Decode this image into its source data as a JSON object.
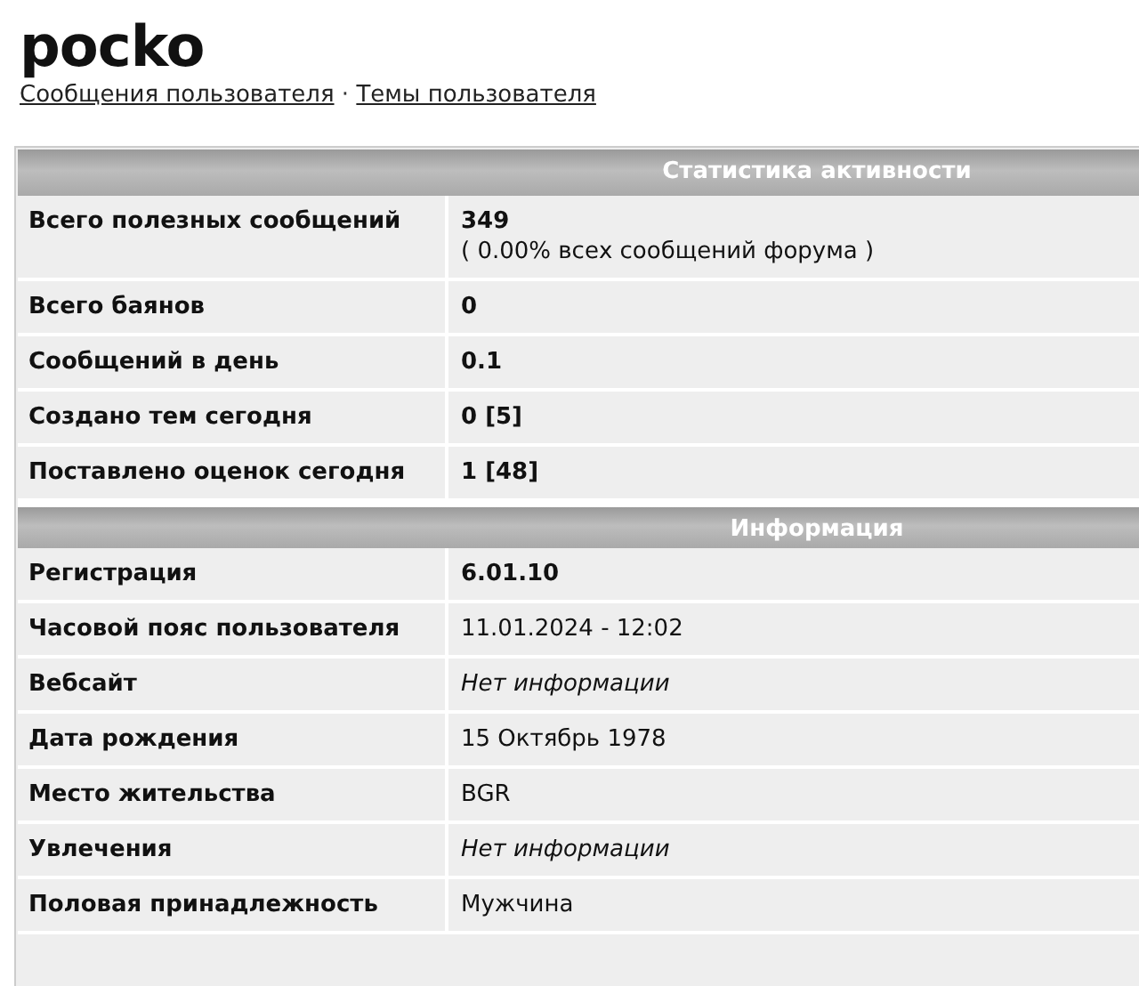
{
  "title": "pocko",
  "links": [
    "Сообщения пользователя",
    "Темы пользователя"
  ],
  "link_separator": "·",
  "sections": [
    {
      "heading": "Статистика активности",
      "rows": [
        {
          "label": "Всего полезных сообщений",
          "value": "349",
          "kind": "bold",
          "note": "( 0.00% всех сообщений форума )"
        },
        {
          "label": "Всего баянов",
          "value": "0",
          "kind": "bold"
        },
        {
          "label": "Сообщений в день",
          "value": "0.1",
          "kind": "bold"
        },
        {
          "label": "Создано тем сегодня",
          "value": "0 [5]",
          "kind": "bold"
        },
        {
          "label": "Поставлено оценок сегодня",
          "value": "1 [48]",
          "kind": "bold"
        }
      ]
    },
    {
      "heading": "Информация",
      "rows": [
        {
          "label": "Регистрация",
          "value": "6.01.10",
          "kind": "bold"
        },
        {
          "label": "Часовой пояс пользователя",
          "value": "11.01.2024 - 12:02",
          "kind": "plain"
        },
        {
          "label": "Вебсайт",
          "value": "Нет информации",
          "kind": "italic"
        },
        {
          "label": "Дата рождения",
          "value": "15 Октябрь 1978",
          "kind": "plain"
        },
        {
          "label": "Место жительства",
          "value": "BGR",
          "kind": "plain"
        },
        {
          "label": "Увлечения",
          "value": "Нет информации",
          "kind": "italic"
        },
        {
          "label": "Половая принадлежность",
          "value": "Мужчина",
          "kind": "plain"
        }
      ]
    }
  ]
}
